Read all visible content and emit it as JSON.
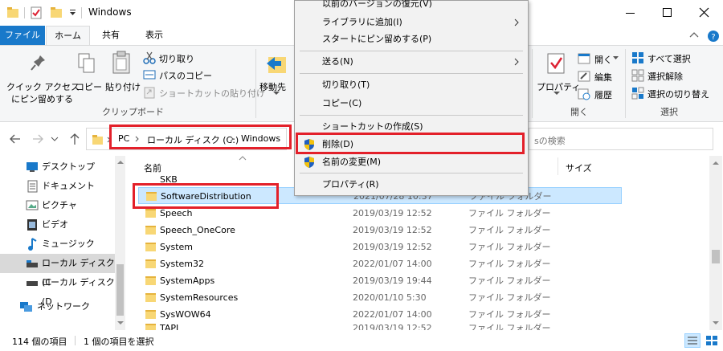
{
  "window": {
    "title": "Windows"
  },
  "tabs": [
    {
      "label": "ファイル"
    },
    {
      "label": "ホーム"
    },
    {
      "label": "共有"
    },
    {
      "label": "表示"
    }
  ],
  "ribbon": {
    "pin_quick": "クイック アクセス",
    "pin_quick2": "にピン留めする",
    "copy": "コピー",
    "paste": "貼り付け",
    "cut": "切り取り",
    "copy_path": "パスのコピー",
    "paste_shortcut": "ショートカットの貼り付け",
    "clipboard_group": "クリップボード",
    "move_to": "移動先",
    "properties": "プロパティ",
    "open": "開く",
    "edit": "編集",
    "history": "履歴",
    "open_group": "開く",
    "select_all": "すべて選択",
    "select_none": "選択解除",
    "invert_selection": "選択の切り替え",
    "select_group": "選択"
  },
  "address": {
    "crumbs": [
      "PC",
      "ローカル ディスク (C:)",
      "Windows"
    ],
    "search_placeholder": "sの検索"
  },
  "columns": {
    "name": "名前",
    "size": "サイズ"
  },
  "nav": [
    {
      "label": "デスクトップ"
    },
    {
      "label": "ドキュメント"
    },
    {
      "label": "ピクチャ"
    },
    {
      "label": "ビデオ"
    },
    {
      "label": "ミュージック"
    },
    {
      "label": "ローカル ディスク (C"
    },
    {
      "label": "ローカル ディスク (D"
    },
    {
      "label": "ネットワーク"
    }
  ],
  "files": [
    {
      "name": "SKB",
      "date": "",
      "type": ""
    },
    {
      "name": "SoftwareDistribution",
      "date": "2021/07/28 10:37",
      "type": "ファイル フォルダー"
    },
    {
      "name": "Speech",
      "date": "2019/03/19 12:52",
      "type": "ファイル フォルダー"
    },
    {
      "name": "Speech_OneCore",
      "date": "2019/03/19 12:52",
      "type": "ファイル フォルダー"
    },
    {
      "name": "System",
      "date": "2019/03/19 12:52",
      "type": "ファイル フォルダー"
    },
    {
      "name": "System32",
      "date": "2022/01/07 14:00",
      "type": "ファイル フォルダー"
    },
    {
      "name": "SystemApps",
      "date": "2019/03/19 19:44",
      "type": "ファイル フォルダー"
    },
    {
      "name": "SystemResources",
      "date": "2020/01/10 5:30",
      "type": "ファイル フォルダー"
    },
    {
      "name": "SysWOW64",
      "date": "2022/01/07 14:00",
      "type": "ファイル フォルダー"
    },
    {
      "name": "TAPI",
      "date": "2019/03/19 12:52",
      "type": "ファイル フォルダー"
    }
  ],
  "context_menu": [
    {
      "label": "以前のバージョンの復元(V)"
    },
    {
      "label": "ライブラリに追加(I)"
    },
    {
      "label": "スタートにピン留めする(P)"
    },
    {
      "label": "送る(N)"
    },
    {
      "label": "切り取り(T)"
    },
    {
      "label": "コピー(C)"
    },
    {
      "label": "ショートカットの作成(S)"
    },
    {
      "label": "削除(D)"
    },
    {
      "label": "名前の変更(M)"
    },
    {
      "label": "プロパティ(R)"
    }
  ],
  "status": {
    "count": "114 個の項目",
    "selected": "1 個の項目を選択"
  },
  "colors": {
    "accent": "#1979ca",
    "highlight": "#cce8ff",
    "red": "#e3202a"
  }
}
